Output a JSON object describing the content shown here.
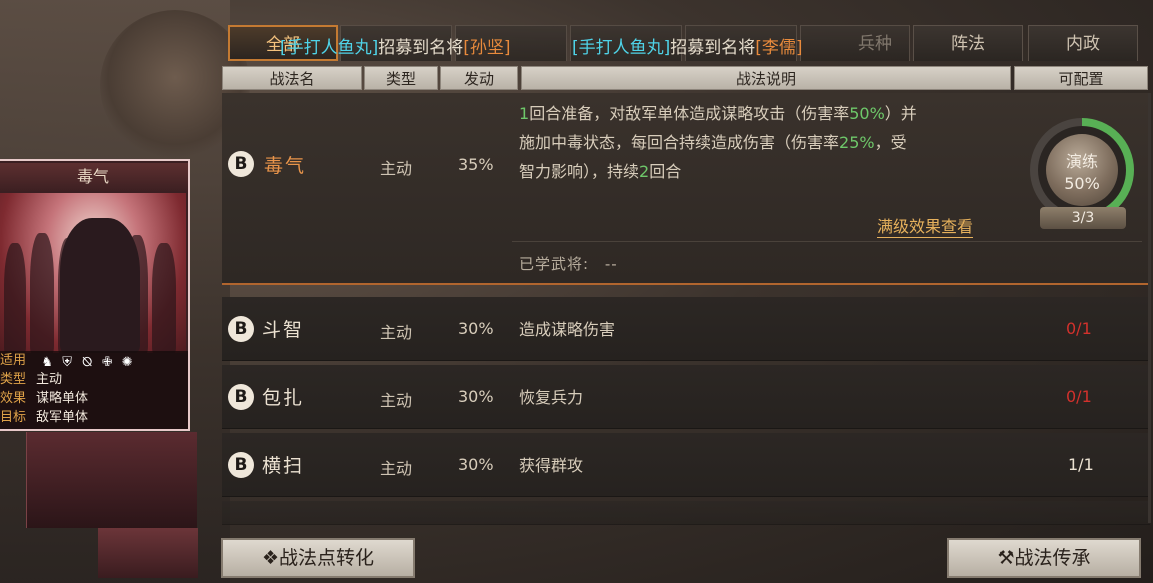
{
  "tabs": [
    {
      "label": "全部"
    },
    {
      "label": "阵法"
    },
    {
      "label": "内政"
    }
  ],
  "ticker": [
    {
      "prefix": "[手打人鱼丸]",
      "mid": "招募到名将",
      "name": "[孙坚]"
    },
    {
      "prefix": "[手打人鱼丸]",
      "mid": "招募到名将",
      "name": "[李儒]"
    }
  ],
  "ghost_tab": "兵种",
  "headers": {
    "name": "战法名",
    "type": "类型",
    "trigger": "发动",
    "desc": "战法说明",
    "config": "可配置"
  },
  "selected_skill": {
    "grade": "B",
    "name": "毒气",
    "type": "主动",
    "rate": "35%",
    "desc_lines": [
      [
        "1",
        "回合准备，对敌军单体造成谋略攻击（伤害率",
        "50%",
        "）并"
      ],
      [
        "施加中毒状态，每回合持续造成伤害（伤害率",
        "25%",
        "，受"
      ],
      [
        "智力影响），持续",
        "2",
        "回合"
      ]
    ],
    "link": "满级效果查看",
    "learned_label": "已学武将:",
    "learned_value": "--",
    "practice": {
      "label": "演练",
      "percent": "50%",
      "count": "3/3",
      "progress": 0.5
    }
  },
  "skills": [
    {
      "grade": "B",
      "name": "斗智",
      "type": "主动",
      "rate": "30%",
      "desc": "造成谋略伤害",
      "count": "0/1",
      "count_color": "red"
    },
    {
      "grade": "B",
      "name": "包扎",
      "type": "主动",
      "rate": "30%",
      "desc": "恢复兵力",
      "count": "0/1",
      "count_color": "red"
    },
    {
      "grade": "B",
      "name": "横扫",
      "type": "主动",
      "rate": "30%",
      "desc": "获得群攻",
      "count": "1/1",
      "count_color": "white"
    }
  ],
  "card": {
    "title": "毒气",
    "suit_label": "适用",
    "type_label": "类型",
    "type_value": "主动",
    "effect_label": "效果",
    "effect_value": "谋略单体",
    "target_label": "目标",
    "target_value": "敌军单体",
    "unit_icons": [
      "cavalry-icon",
      "shield-icon",
      "bow-icon",
      "spear-icon",
      "wheel-icon"
    ]
  },
  "buttons": {
    "convert": "战法点转化",
    "inherit": "战法传承"
  }
}
